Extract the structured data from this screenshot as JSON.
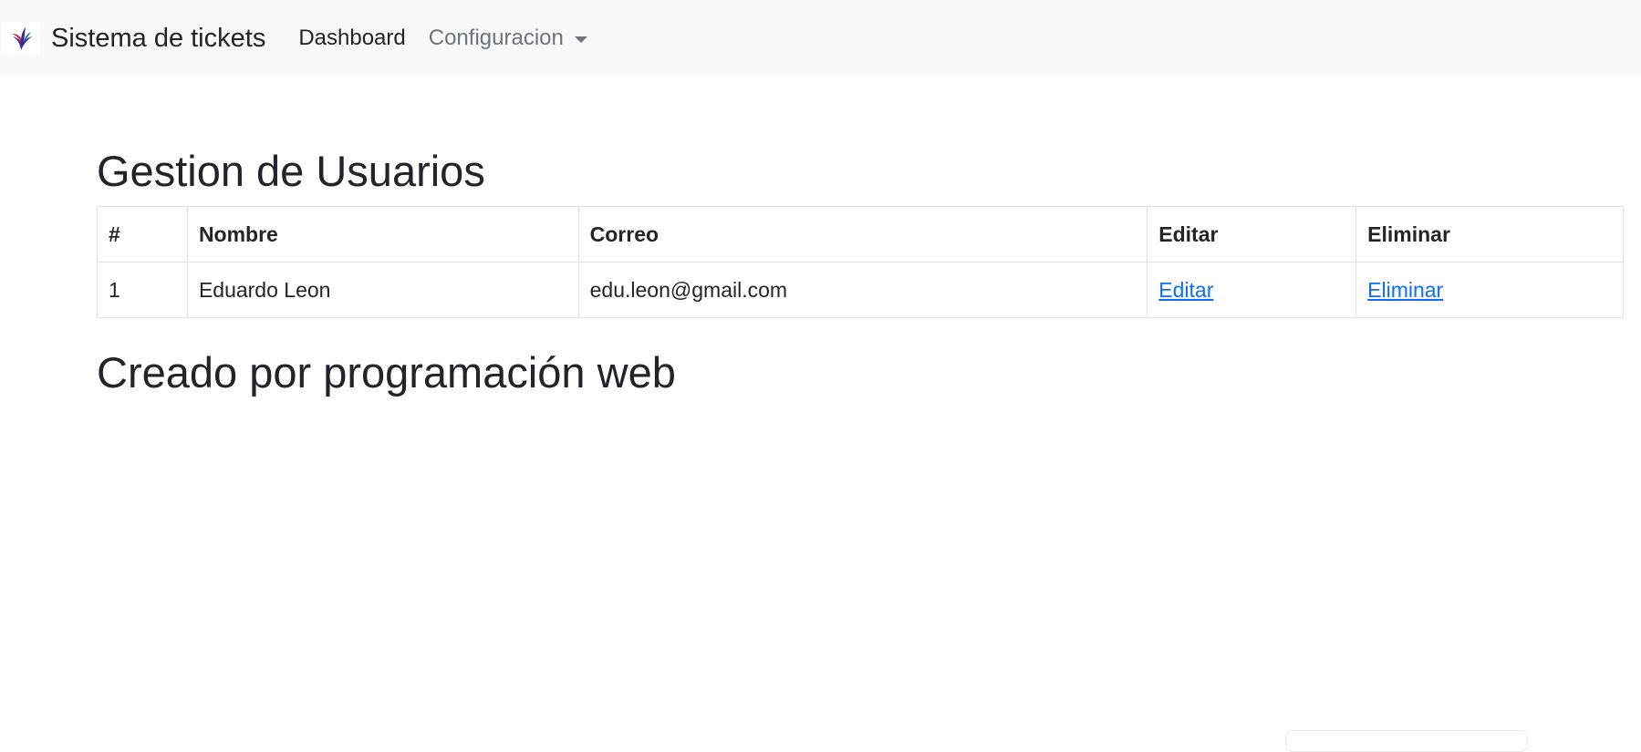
{
  "navbar": {
    "brand": "Sistema de tickets",
    "brand_icon": "bird-logo-icon",
    "links": {
      "dashboard": "Dashboard",
      "configuracion": "Configuracion"
    }
  },
  "main": {
    "title": "Gestion de Usuarios",
    "table": {
      "headers": [
        "#",
        "Nombre",
        "Correo",
        "Editar",
        "Eliminar"
      ],
      "rows": [
        {
          "id": "1",
          "nombre": "Eduardo Leon",
          "correo": "edu.leon@gmail.com",
          "editar": "Editar",
          "eliminar": "Eliminar"
        }
      ]
    },
    "footer": "Creado por programación web"
  },
  "colors": {
    "navbar_bg": "#f8f9fa",
    "link": "#0d6efd",
    "muted": "#6c757d",
    "text": "#212529"
  }
}
